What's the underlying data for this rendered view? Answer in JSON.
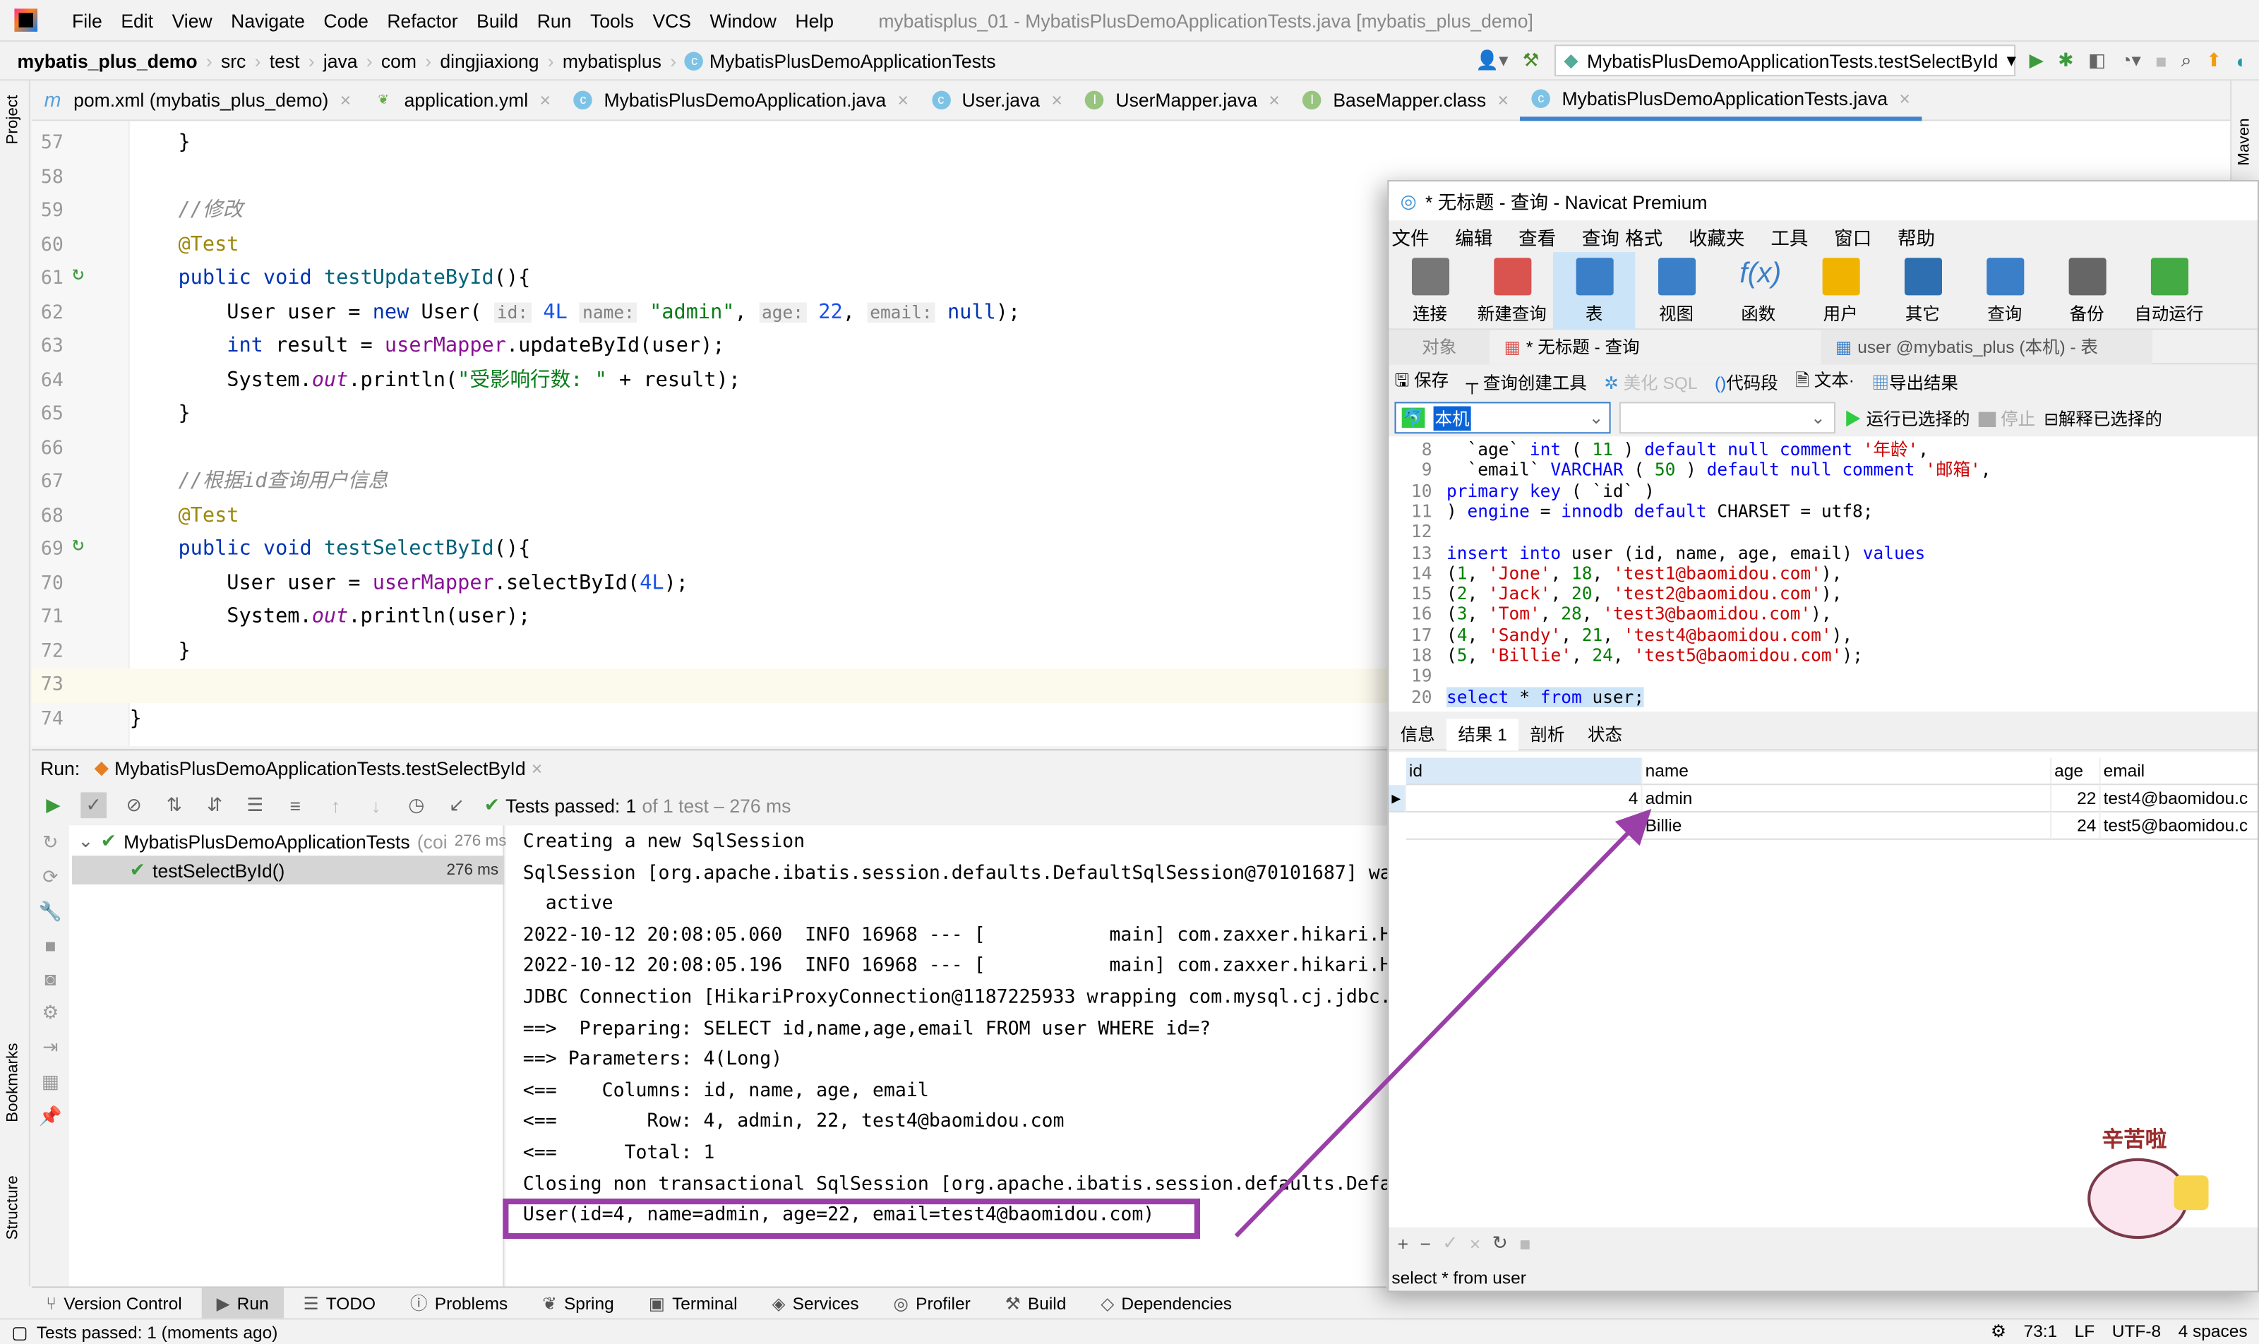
{
  "ide": {
    "menu": [
      "File",
      "Edit",
      "View",
      "Navigate",
      "Code",
      "Refactor",
      "Build",
      "Run",
      "Tools",
      "VCS",
      "Window",
      "Help"
    ],
    "window_title": "mybatisplus_01 - MybatisPlusDemoApplicationTests.java [mybatis_plus_demo]",
    "breadcrumb": [
      "mybatis_plus_demo",
      "src",
      "test",
      "java",
      "com",
      "dingjiaxiong",
      "mybatisplus",
      "MybatisPlusDemoApplicationTests"
    ],
    "run_config": "MybatisPlusDemoApplicationTests.testSelectById",
    "left_strip": [
      "Project",
      "Bookmarks",
      "Structure"
    ],
    "right_strip": [
      "Maven"
    ],
    "tabs": [
      {
        "label": "pom.xml (mybatis_plus_demo)",
        "icon": "maven-icon"
      },
      {
        "label": "application.yml",
        "icon": "spring-config-icon"
      },
      {
        "label": "MybatisPlusDemoApplication.java",
        "icon": "class-icon"
      },
      {
        "label": "User.java",
        "icon": "class-icon"
      },
      {
        "label": "UserMapper.java",
        "icon": "interface-icon"
      },
      {
        "label": "BaseMapper.class",
        "icon": "interface-icon"
      },
      {
        "label": "MybatisPlusDemoApplicationTests.java",
        "icon": "class-icon",
        "active": true
      }
    ],
    "code": [
      {
        "n": "57",
        "t": [
          [
            "",
            "    }"
          ]
        ]
      },
      {
        "n": "58",
        "t": []
      },
      {
        "n": "59",
        "t": [
          [
            "cmt",
            "    //修改"
          ]
        ]
      },
      {
        "n": "60",
        "t": [
          [
            "ann",
            "    @Test"
          ]
        ]
      },
      {
        "n": "61",
        "t": [
          [
            "kw",
            "    public void "
          ],
          [
            "mth",
            "testUpdateById"
          ],
          [
            "",
            "(){"
          ]
        ]
      },
      {
        "n": "62",
        "t": [
          [
            "",
            "        User user = "
          ],
          [
            "kw",
            "new "
          ],
          [
            "",
            "User( "
          ],
          [
            "hint",
            "id:"
          ],
          [
            "num",
            " 4L"
          ],
          [
            ",",
            " "
          ],
          [
            "hint",
            "name:"
          ],
          [
            "str",
            " \"admin\""
          ],
          [
            "",
            ", "
          ],
          [
            "hint",
            "age:"
          ],
          [
            "num",
            " 22"
          ],
          [
            "",
            ", "
          ],
          [
            "hint",
            "email:"
          ],
          [
            "kw",
            " null"
          ],
          [
            "",
            ");"
          ]
        ]
      },
      {
        "n": "63",
        "t": [
          [
            "kw",
            "        int "
          ],
          [
            "",
            "result = "
          ],
          [
            "fld",
            "userMapper"
          ],
          [
            "",
            ".updateById(user);"
          ]
        ]
      },
      {
        "n": "64",
        "t": [
          [
            "",
            "        System."
          ],
          [
            "st",
            "out"
          ],
          [
            "",
            ".println("
          ],
          [
            "str",
            "\"受影响行数: \""
          ],
          [
            "",
            " + result);"
          ]
        ]
      },
      {
        "n": "65",
        "t": [
          [
            "",
            "    }"
          ]
        ]
      },
      {
        "n": "66",
        "t": []
      },
      {
        "n": "67",
        "t": [
          [
            "cmt",
            "    //根据id查询用户信息"
          ]
        ]
      },
      {
        "n": "68",
        "t": [
          [
            "ann",
            "    @Test"
          ]
        ]
      },
      {
        "n": "69",
        "t": [
          [
            "kw",
            "    public void "
          ],
          [
            "mth",
            "testSelectById"
          ],
          [
            "",
            "(){"
          ]
        ]
      },
      {
        "n": "70",
        "t": [
          [
            "",
            "        User user = "
          ],
          [
            "fld",
            "userMapper"
          ],
          [
            "",
            ".selectById("
          ],
          [
            "num",
            "4L"
          ],
          [
            "",
            ");"
          ]
        ]
      },
      {
        "n": "71",
        "t": [
          [
            "",
            "        System."
          ],
          [
            "st",
            "out"
          ],
          [
            "",
            ".println(user);"
          ]
        ]
      },
      {
        "n": "72",
        "t": [
          [
            "",
            "    }"
          ]
        ]
      },
      {
        "n": "73",
        "t": [],
        "current": true
      },
      {
        "n": "74",
        "t": [
          [
            "",
            "}"
          ]
        ]
      }
    ],
    "run": {
      "label": "Run:",
      "tab": "MybatisPlusDemoApplicationTests.testSelectById",
      "tests_passed": "Tests passed: ",
      "tests_count": "1",
      "tests_suffix": " of 1 test – 276 ms",
      "tree": [
        {
          "label": "MybatisPlusDemoApplicationTests",
          "sub": "(coi",
          "time": "276 ms"
        },
        {
          "label": "testSelectById()",
          "time": "276 ms"
        }
      ],
      "console": [
        "Creating a new SqlSession",
        "SqlSession [org.apache.ibatis.session.defaults.DefaultSqlSession@70101687] wa",
        "  active",
        "2022-10-12 20:08:05.060  INFO 16968 --- [           main] com.zaxxer.hikari.H",
        "2022-10-12 20:08:05.196  INFO 16968 --- [           main] com.zaxxer.hikari.H",
        "JDBC Connection [HikariProxyConnection@1187225933 wrapping com.mysql.cj.jdbc.",
        "==>  Preparing: SELECT id,name,age,email FROM user WHERE id=?",
        "==> Parameters: 4(Long)",
        "<==    Columns: id, name, age, email",
        "<==        Row: 4, admin, 22, test4@baomidou.com",
        "<==      Total: 1",
        "Closing non transactional SqlSession [org.apache.ibatis.session.defaults.Defa",
        "User(id=4, name=admin, age=22, email=test4@baomidou.com)"
      ]
    },
    "toolwindows": [
      "Version Control",
      "Run",
      "TODO",
      "Problems",
      "Spring",
      "Terminal",
      "Services",
      "Profiler",
      "Build",
      "Dependencies"
    ],
    "status": {
      "left": "Tests passed: 1 (moments ago)",
      "pos": "73:1",
      "le": "LF",
      "enc": "UTF-8",
      "indent": "4 spaces"
    },
    "highlight_color": "#9a3fa8"
  },
  "navicat": {
    "title": "* 无标题 - 查询 - Navicat Premium",
    "menu": [
      "文件",
      "编辑",
      "查看",
      "查询",
      "格式",
      "收藏夹",
      "工具",
      "窗口",
      "帮助"
    ],
    "toolbar": [
      "连接",
      "新建查询",
      "表",
      "视图",
      "函数",
      "用户",
      "其它",
      "查询",
      "备份",
      "自动运行"
    ],
    "tabs": [
      "对象",
      "* 无标题 - 查询",
      "user @mybatis_plus (本机) - 表"
    ],
    "query_toolbar": [
      "保存",
      "查询创建工具",
      "美化 SQL",
      "代码段",
      "文本",
      "导出结果"
    ],
    "connection": "本机",
    "run_selected": "运行已选择的",
    "stop": "停止",
    "explain": "解释已选择的",
    "sql": [
      {
        "n": "8",
        "t": [
          [
            "",
            "  `age` "
          ],
          [
            "skw",
            "int"
          ],
          [
            "",
            " ( "
          ],
          [
            "snum",
            "11"
          ],
          [
            "",
            " ) "
          ],
          [
            "skw",
            "default null comment "
          ],
          [
            "sstr",
            "'年龄'"
          ],
          [
            "",
            ","
          ]
        ]
      },
      {
        "n": "9",
        "t": [
          [
            "",
            "  `email` "
          ],
          [
            "skw",
            "VARCHAR"
          ],
          [
            "",
            " ( "
          ],
          [
            "snum",
            "50"
          ],
          [
            "",
            " ) "
          ],
          [
            "skw",
            "default null comment "
          ],
          [
            "sstr",
            "'邮箱'"
          ],
          [
            "",
            ","
          ]
        ]
      },
      {
        "n": "10",
        "t": [
          [
            "skw",
            "primary key"
          ],
          [
            "",
            " ( `id` )"
          ]
        ]
      },
      {
        "n": "11",
        "t": [
          [
            "",
            ") "
          ],
          [
            "skw",
            "engine"
          ],
          [
            "",
            " = "
          ],
          [
            "skw",
            "innodb default"
          ],
          [
            "",
            " CHARSET = utf8;"
          ]
        ]
      },
      {
        "n": "12",
        "t": []
      },
      {
        "n": "13",
        "t": [
          [
            "skw",
            "insert into"
          ],
          [
            "",
            " user (id, name, age, email) "
          ],
          [
            "skw",
            "values"
          ]
        ]
      },
      {
        "n": "14",
        "t": [
          [
            "",
            "("
          ],
          [
            "snum",
            "1"
          ],
          [
            "",
            ", "
          ],
          [
            "sstr",
            "'Jone'"
          ],
          [
            "",
            ", "
          ],
          [
            "snum",
            "18"
          ],
          [
            "",
            ", "
          ],
          [
            "sstr",
            "'test1@baomidou.com'"
          ],
          [
            "",
            "),"
          ]
        ]
      },
      {
        "n": "15",
        "t": [
          [
            "",
            "("
          ],
          [
            "snum",
            "2"
          ],
          [
            "",
            ", "
          ],
          [
            "sstr",
            "'Jack'"
          ],
          [
            "",
            ", "
          ],
          [
            "snum",
            "20"
          ],
          [
            "",
            ", "
          ],
          [
            "sstr",
            "'test2@baomidou.com'"
          ],
          [
            "",
            "),"
          ]
        ]
      },
      {
        "n": "16",
        "t": [
          [
            "",
            "("
          ],
          [
            "snum",
            "3"
          ],
          [
            "",
            ", "
          ],
          [
            "sstr",
            "'Tom'"
          ],
          [
            "",
            ", "
          ],
          [
            "snum",
            "28"
          ],
          [
            "",
            ", "
          ],
          [
            "sstr",
            "'test3@baomidou.com'"
          ],
          [
            "",
            "),"
          ]
        ]
      },
      {
        "n": "17",
        "t": [
          [
            "",
            "("
          ],
          [
            "snum",
            "4"
          ],
          [
            "",
            ", "
          ],
          [
            "sstr",
            "'Sandy'"
          ],
          [
            "",
            ", "
          ],
          [
            "snum",
            "21"
          ],
          [
            "",
            ", "
          ],
          [
            "sstr",
            "'test4@baomidou.com'"
          ],
          [
            "",
            "),"
          ]
        ]
      },
      {
        "n": "18",
        "t": [
          [
            "",
            "("
          ],
          [
            "snum",
            "5"
          ],
          [
            "",
            ", "
          ],
          [
            "sstr",
            "'Billie'"
          ],
          [
            "",
            ", "
          ],
          [
            "snum",
            "24"
          ],
          [
            "",
            ", "
          ],
          [
            "sstr",
            "'test5@baomidou.com'"
          ],
          [
            "",
            ");"
          ]
        ]
      },
      {
        "n": "19",
        "t": []
      },
      {
        "n": "20",
        "t": [
          [
            "skw",
            "select"
          ],
          [
            "",
            " * "
          ],
          [
            "skw",
            "from"
          ],
          [
            "",
            " user;"
          ]
        ],
        "selected": true
      }
    ],
    "result_tabs": [
      "信息",
      "结果 1",
      "剖析",
      "状态"
    ],
    "columns": [
      "id",
      "name",
      "age",
      "email"
    ],
    "rows": [
      [
        "4",
        "admin",
        "22",
        "test4@baomidou.c"
      ],
      [
        "5",
        "Billie",
        "24",
        "test5@baomidou.c"
      ]
    ],
    "footer_sql": "select * from user",
    "sticker_text": "辛苦啦"
  }
}
